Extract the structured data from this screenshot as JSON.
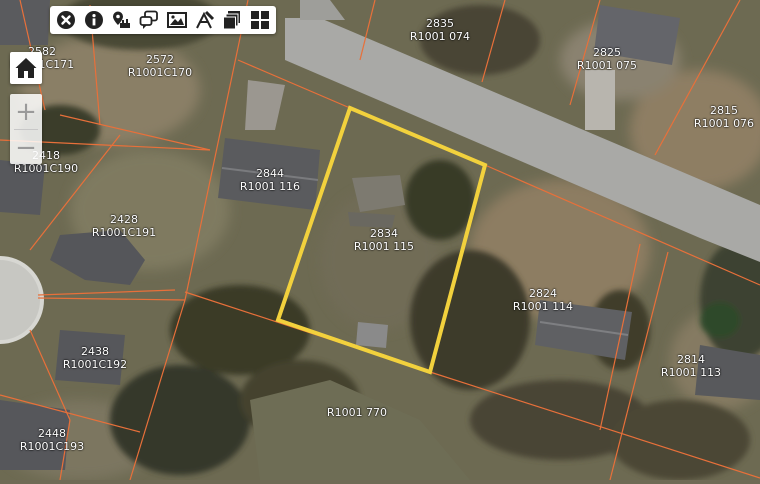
{
  "map": {
    "colors": {
      "parcel_line": "#e8703a",
      "selection": "#f2d13d",
      "road": "#a9a9a6",
      "grass": "#7a7a5c",
      "trees": "#3c3d2a",
      "roof": "#5c5d60"
    },
    "selected_parcel": {
      "address": "2834",
      "parcel_id": "R1001 115"
    },
    "parcels": [
      {
        "address": "2835",
        "parcel_id": "R1001 074"
      },
      {
        "address": "2825",
        "parcel_id": "R1001 075"
      },
      {
        "address": "2815",
        "parcel_id": "R1001 076"
      },
      {
        "address": "2582",
        "parcel_id": "R1001C171"
      },
      {
        "address": "2572",
        "parcel_id": "R1001C170"
      },
      {
        "address": "2418",
        "parcel_id": "R1001C190"
      },
      {
        "address": "2844",
        "parcel_id": "R1001 116"
      },
      {
        "address": "2428",
        "parcel_id": "R1001C191"
      },
      {
        "address": "2824",
        "parcel_id": "R1001 114"
      },
      {
        "address": "2438",
        "parcel_id": "R1001C192"
      },
      {
        "address": "2814",
        "parcel_id": "R1001 113"
      },
      {
        "address": "",
        "parcel_id": "R1001 770"
      },
      {
        "address": "2448",
        "parcel_id": "R1001C193"
      }
    ]
  },
  "toolbar": {
    "tools": [
      {
        "icon": "close-circle-icon"
      },
      {
        "icon": "info-icon"
      },
      {
        "icon": "location-pin-icon"
      },
      {
        "icon": "chat-bubbles-icon"
      },
      {
        "icon": "image-icon"
      },
      {
        "icon": "measure-icon"
      },
      {
        "icon": "layers-icon"
      },
      {
        "icon": "grid-icon"
      }
    ]
  },
  "controls": {
    "home_icon": "home-icon",
    "zoom_in": "+",
    "zoom_out": "−"
  }
}
